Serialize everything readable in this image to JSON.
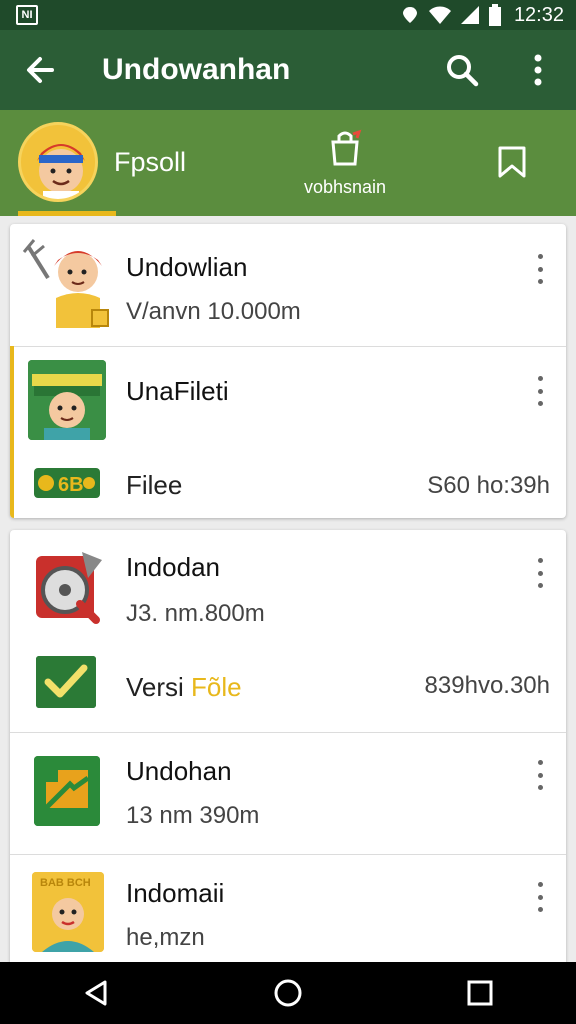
{
  "status_bar": {
    "notification_label": "NI",
    "time": "12:32"
  },
  "toolbar": {
    "title": "Undowanhan"
  },
  "tabs": {
    "profile_name": "Fpsoll",
    "downloads_label": "vobhsnain"
  },
  "items": [
    {
      "title": "Undowlian",
      "subtitle": "V/anvn 10.000m"
    },
    {
      "title": "UnaFileti",
      "file_label": "Filee",
      "file_meta": "S60 ho:39h",
      "badge_text": "6B"
    },
    {
      "title": "Indodan",
      "subtitle": "J3. nm.800m",
      "version_prefix": "Versi ",
      "version_highlight": "Fõle",
      "version_meta": "839hvo.30h"
    },
    {
      "title": "Undohan",
      "subtitle": "13 nm 390m"
    },
    {
      "title": "Indomaii",
      "subtitle": "he,mzn",
      "thumb_text": "BAB BCH"
    }
  ],
  "colors": {
    "status_bar": "#1f4a2a",
    "toolbar": "#2b5d36",
    "tabbar": "#5b8d3e",
    "accent": "#e8b81c"
  }
}
